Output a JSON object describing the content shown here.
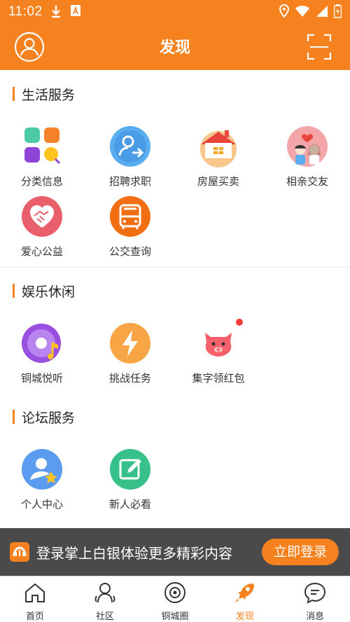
{
  "status_bar": {
    "time": "11:02"
  },
  "header": {
    "title": "发现"
  },
  "sections": {
    "life": {
      "title": "生活服务",
      "items": [
        "分类信息",
        "招聘求职",
        "房屋买卖",
        "相亲交友",
        "爱心公益",
        "公交查询"
      ]
    },
    "entertainment": {
      "title": "娱乐休闲",
      "items": [
        "铜城悦听",
        "挑战任务",
        "集字领红包"
      ]
    },
    "forum": {
      "title": "论坛服务",
      "items": [
        "个人中心",
        "新人必看"
      ]
    }
  },
  "banner": {
    "message": "登录掌上白银体验更多精彩内容",
    "login_label": "立即登录"
  },
  "tabbar": {
    "tabs": [
      "首页",
      "社区",
      "铜城圈",
      "发现",
      "消息"
    ],
    "active": "发现"
  },
  "colors": {
    "accent": "#f5821f",
    "banner_bg": "#4a4a4a"
  }
}
